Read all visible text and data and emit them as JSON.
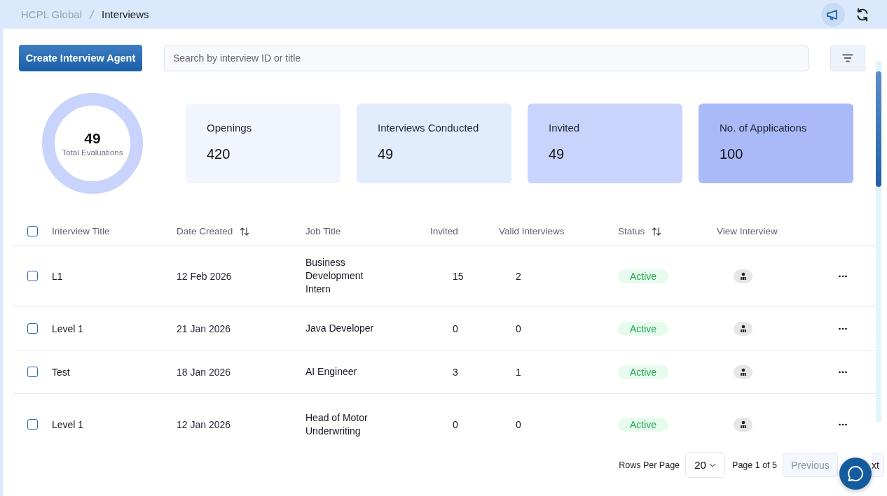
{
  "breadcrumb": [
    {
      "label": "HCPL Global",
      "current": false
    },
    {
      "label": "Interviews",
      "current": true
    }
  ],
  "header_actions": [
    {
      "kind": "megaphone",
      "selected": true
    },
    {
      "kind": "refresh",
      "selected": false
    }
  ],
  "toolbar": {
    "create_button": "Create Interview Agent",
    "search": {
      "placeholder": "Search by interview ID or title"
    }
  },
  "summary": {
    "total": "49",
    "total_label": "Total Evaluations"
  },
  "stats": [
    {
      "label": "Openings",
      "value": "420",
      "color": "#f1f6fe"
    },
    {
      "label": "Interviews Conducted",
      "value": "49",
      "color": "#e1ecfd"
    },
    {
      "label": "Invited",
      "value": "49",
      "color": "#c8d4fb"
    },
    {
      "label": "No. of Applications",
      "value": "100",
      "color": "#aab9f8"
    }
  ],
  "table": {
    "select_all": {
      "checked": false
    },
    "columns": [
      {
        "label": "Interview Title",
        "sortable": false
      },
      {
        "label": "Date Created",
        "sortable": true
      },
      {
        "label": "Job Title",
        "sortable": false
      },
      {
        "label": "Invited",
        "sortable": false
      },
      {
        "label": "Valid Interviews",
        "sortable": false
      },
      {
        "label": "Status",
        "sortable": true
      },
      {
        "label": "View Interview",
        "sortable": false
      }
    ],
    "rows": [
      {
        "checked": false,
        "title": "L1",
        "date": "12 Feb 2026",
        "job": "Business Development Intern",
        "invited": "15",
        "valid": "2",
        "status": "Active"
      },
      {
        "checked": false,
        "title": "Level 1",
        "date": "21 Jan 2026",
        "job": "Java Developer",
        "invited": "0",
        "valid": "0",
        "status": "Active"
      },
      {
        "checked": false,
        "title": "Test",
        "date": "18 Jan 2026",
        "job": "AI Engineer",
        "invited": "3",
        "valid": "1",
        "status": "Active"
      },
      {
        "checked": false,
        "title": "Level 1",
        "date": "12 Jan 2026",
        "job": "Head of Motor Underwriting",
        "invited": "0",
        "valid": "0",
        "status": "Active"
      }
    ]
  },
  "pagination": {
    "rows_per_page_label": "Rows Per Page",
    "rows_per_page": "20",
    "page_info": "Page 1 of 5",
    "previous": "Previous",
    "next": "xt"
  }
}
